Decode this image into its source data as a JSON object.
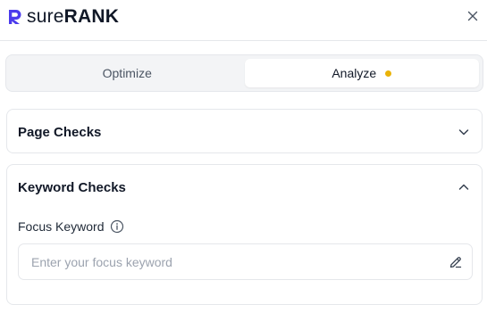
{
  "brand": {
    "sure": "sure",
    "rank": "RANK",
    "mark_color": "#4B3BEC"
  },
  "header": {
    "close_icon": "close-icon"
  },
  "tabs": [
    {
      "label": "Optimize",
      "active": false
    },
    {
      "label": "Analyze",
      "active": true,
      "status_dot_color": "#EAB308"
    }
  ],
  "page_checks": {
    "title": "Page Checks",
    "expanded": false,
    "icon": "chevron-down-icon"
  },
  "keyword_checks": {
    "title": "Keyword Checks",
    "expanded": true,
    "icon": "chevron-up-icon",
    "focus_keyword": {
      "label": "Focus Keyword",
      "info_icon": "info-icon",
      "value": "",
      "placeholder": "Enter your focus keyword",
      "edit_icon": "pencil-icon"
    }
  },
  "colors": {
    "accent": "#4B3BEC",
    "status_dot": "#EAB308",
    "border": "#E5E7EB",
    "tab_bg": "#F3F4F6"
  }
}
